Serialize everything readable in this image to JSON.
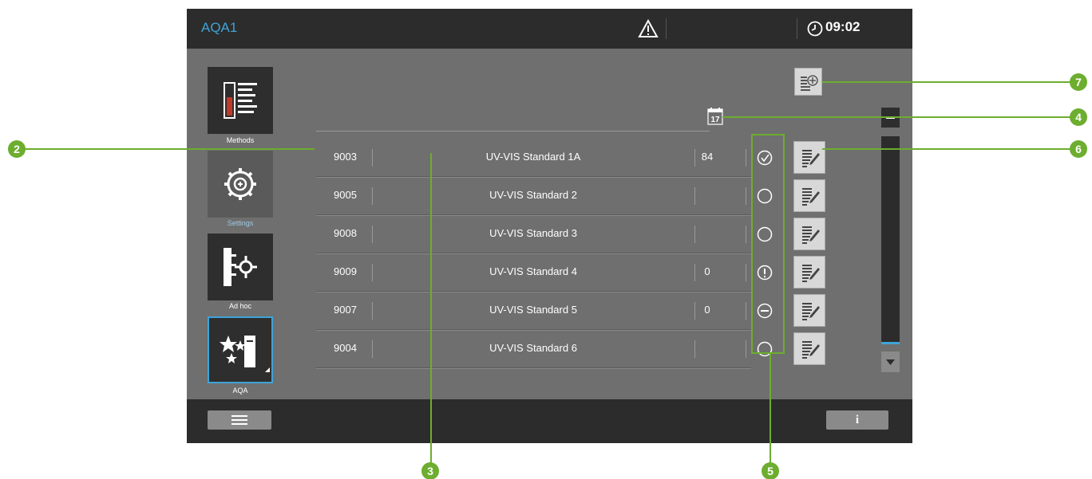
{
  "header": {
    "title": "AQA1",
    "time": "09:02",
    "warning_icon": "warning-triangle-icon",
    "clock_icon": "clock-icon"
  },
  "nav": {
    "items": [
      {
        "label": "Methods",
        "icon": "methods-icon"
      },
      {
        "label": "Settings",
        "icon": "settings-gear-icon"
      },
      {
        "label": "Ad hoc",
        "icon": "ad-hoc-icon"
      },
      {
        "label": "AQA",
        "icon": "aqa-stars-icon"
      }
    ]
  },
  "table": {
    "rows": [
      {
        "id": "9003",
        "name": "UV-VIS Standard 1A",
        "count": "84",
        "status": "check"
      },
      {
        "id": "9005",
        "name": "UV-VIS Standard 2",
        "count": "",
        "status": "empty"
      },
      {
        "id": "9008",
        "name": "UV-VIS Standard 3",
        "count": "",
        "status": "empty"
      },
      {
        "id": "9009",
        "name": "UV-VIS Standard 4",
        "count": "0",
        "status": "warning"
      },
      {
        "id": "9007",
        "name": "UV-VIS Standard 5",
        "count": "0",
        "status": "disabled"
      },
      {
        "id": "9004",
        "name": "UV-VIS Standard 6",
        "count": "",
        "status": "empty"
      }
    ]
  },
  "calendar": {
    "day": "17"
  },
  "footer": {
    "info_label": "i"
  },
  "callouts": [
    "2",
    "3",
    "4",
    "5",
    "6",
    "7"
  ],
  "colors": {
    "accent": "#3ea4d8",
    "callout_green": "#6dad2f",
    "screen_bg": "#6f6f6f",
    "bar_bg": "#2c2c2c"
  }
}
